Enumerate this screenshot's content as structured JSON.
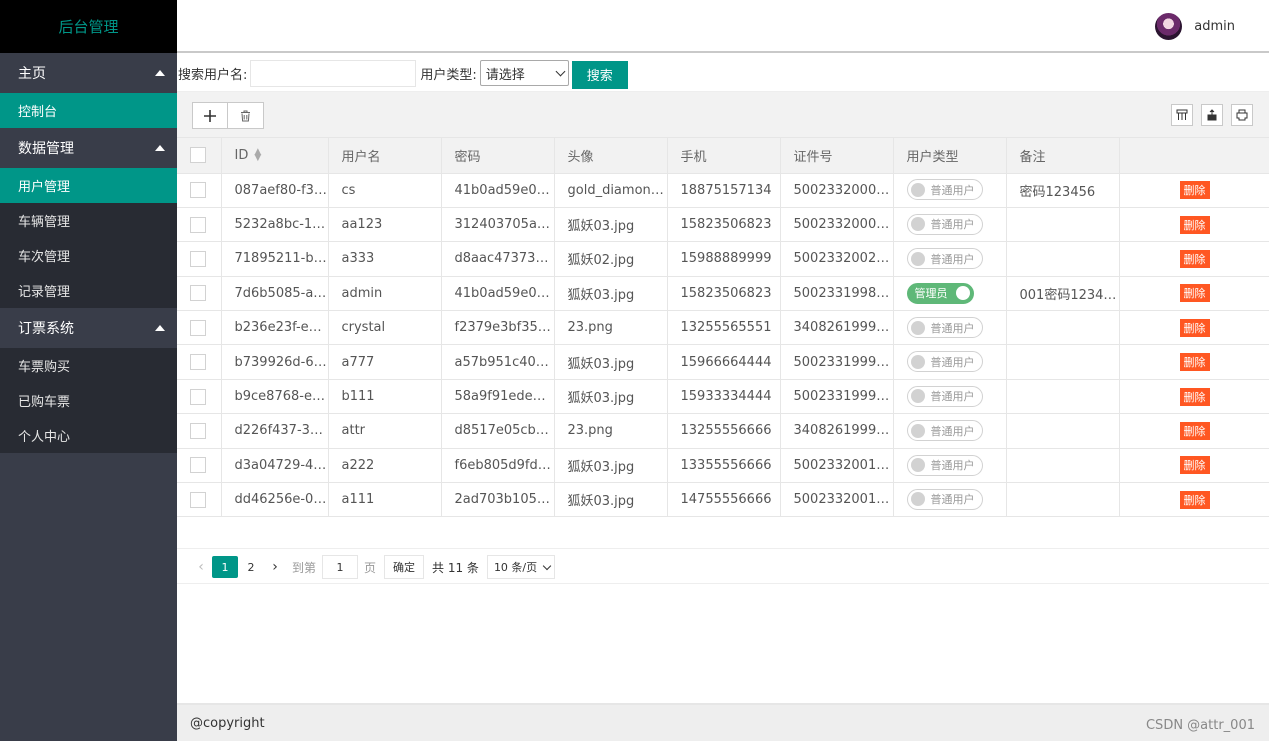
{
  "sidebar": {
    "title": "后台管理",
    "groups": [
      {
        "label": "主页",
        "items": [
          "控制台"
        ]
      },
      {
        "label": "数据管理",
        "items": [
          "用户管理",
          "车辆管理",
          "车次管理",
          "记录管理"
        ]
      },
      {
        "label": "订票系统",
        "items": [
          "车票购买",
          "已购车票",
          "个人中心"
        ]
      }
    ],
    "active_items": [
      "控制台",
      "用户管理"
    ]
  },
  "header": {
    "username": "admin"
  },
  "search": {
    "username_label": "搜索用户名:",
    "username_value": "",
    "type_label": "用户类型:",
    "type_selected": "请选择",
    "button": "搜索"
  },
  "toolbar": {
    "add_icon": "plus-icon",
    "delete_icon": "trash-icon",
    "right_icons": [
      "columns-icon",
      "export-icon",
      "print-icon"
    ]
  },
  "table": {
    "columns": [
      "ID",
      "用户名",
      "密码",
      "头像",
      "手机",
      "证件号",
      "用户类型",
      "备注",
      ""
    ],
    "rows": [
      {
        "id": "087aef80-f3…",
        "username": "cs",
        "password": "41b0ad59e0…",
        "avatar": "gold_diamon…",
        "phone": "18875157134",
        "idcard": "5002332000…",
        "type": "普通用户",
        "admin": false,
        "note": "密码123456",
        "action": "删除"
      },
      {
        "id": "5232a8bc-1…",
        "username": "aa123",
        "password": "312403705a…",
        "avatar": "狐妖03.jpg",
        "phone": "15823506823",
        "idcard": "5002332000…",
        "type": "普通用户",
        "admin": false,
        "note": "",
        "action": "删除"
      },
      {
        "id": "71895211-b…",
        "username": "a333",
        "password": "d8aac47373…",
        "avatar": "狐妖02.jpg",
        "phone": "15988889999",
        "idcard": "5002332002…",
        "type": "普通用户",
        "admin": false,
        "note": "",
        "action": "删除"
      },
      {
        "id": "7d6b5085-a…",
        "username": "admin",
        "password": "41b0ad59e0…",
        "avatar": "狐妖03.jpg",
        "phone": "15823506823",
        "idcard": "5002331998…",
        "type": "管理员",
        "admin": true,
        "note": "001密码1234…",
        "action": "删除"
      },
      {
        "id": "b236e23f-e…",
        "username": "crystal",
        "password": "f2379e3bf35…",
        "avatar": "23.png",
        "phone": "13255565551",
        "idcard": "3408261999…",
        "type": "普通用户",
        "admin": false,
        "note": "",
        "action": "删除"
      },
      {
        "id": "b739926d-6…",
        "username": "a777",
        "password": "a57b951c40…",
        "avatar": "狐妖03.jpg",
        "phone": "15966664444",
        "idcard": "5002331999…",
        "type": "普通用户",
        "admin": false,
        "note": "",
        "action": "删除"
      },
      {
        "id": "b9ce8768-e…",
        "username": "b111",
        "password": "58a9f91edeb…",
        "avatar": "狐妖03.jpg",
        "phone": "15933334444",
        "idcard": "5002331999…",
        "type": "普通用户",
        "admin": false,
        "note": "",
        "action": "删除"
      },
      {
        "id": "d226f437-3…",
        "username": "attr",
        "password": "d8517e05cb…",
        "avatar": "23.png",
        "phone": "13255556666",
        "idcard": "3408261999…",
        "type": "普通用户",
        "admin": false,
        "note": "",
        "action": "删除"
      },
      {
        "id": "d3a04729-4…",
        "username": "a222",
        "password": "f6eb805d9fd…",
        "avatar": "狐妖03.jpg",
        "phone": "13355556666",
        "idcard": "5002332001…",
        "type": "普通用户",
        "admin": false,
        "note": "",
        "action": "删除"
      },
      {
        "id": "dd46256e-0…",
        "username": "a111",
        "password": "2ad703b105…",
        "avatar": "狐妖03.jpg",
        "phone": "14755556666",
        "idcard": "5002332001…",
        "type": "普通用户",
        "admin": false,
        "note": "",
        "action": "删除"
      }
    ]
  },
  "pager": {
    "pages": [
      "1",
      "2"
    ],
    "current": "1",
    "goto_label": "到第",
    "goto_value": "1",
    "page_label": "页",
    "confirm": "确定",
    "total": "共 11 条",
    "page_size": "10 条/页"
  },
  "footer": {
    "copyright": "@copyright",
    "watermark": "CSDN @attr_001"
  },
  "colors": {
    "accent": "#009688",
    "sidebar": "#393d49",
    "danger": "#ff5722",
    "switch_on": "#5fb878"
  }
}
